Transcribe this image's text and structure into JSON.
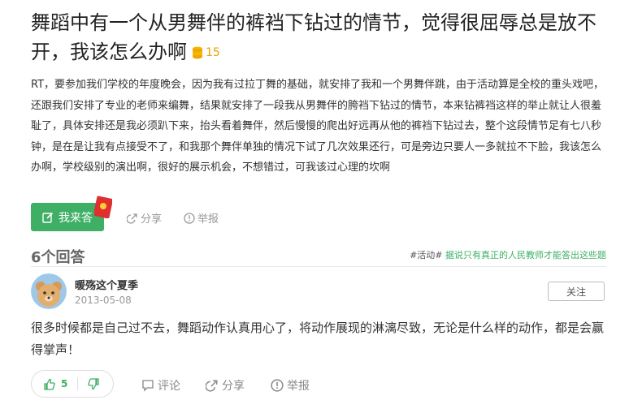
{
  "question": {
    "title": "舞蹈中有一个从男舞伴的裤裆下钻过的情节，觉得很屈辱总是放不开，我该怎么办啊",
    "coins": "15",
    "body": "RT，要参加我们学校的年度晚会，因为我有过拉丁舞的基础，就安排了我和一个男舞伴跳，由于活动算是全校的重头戏吧，还跟我们安排了专业的老师来编舞，结果就安排了一段我从男舞伴的胯裆下钻过的情节，本来钻裤裆这样的举止就让人很羞耻了，具体安排还是我必须趴下来，抬头看着舞伴，然后慢慢的爬出好远再从他的裤裆下钻过去，整个这段情节足有七八秒钟，是在是让我有点接受不了，和我那个舞伴单独的情况下试了几次效果还行，可是旁边只要人一多就拉不下脸，我该怎么办啊，学校级别的演出啊，很好的展示机会，不想错过，可我该过心理的坎啊"
  },
  "question_actions": {
    "answer_label": "我来答",
    "share_label": "分享",
    "report_label": "举报"
  },
  "answers_header": {
    "count_label": "6个回答",
    "activity_tag": "#活动#",
    "activity_link": "据说只有真正的人民教师才能答出这些题"
  },
  "answer": {
    "user_name": "暖殇这个夏季",
    "date": "2013-05-08",
    "follow_label": "关注",
    "text": "很多时候都是自己过不去，舞蹈动作认真用心了，将动作展现的淋漓尽致，无论是什么样的动作，都是会赢得掌声！",
    "upvotes": "5",
    "comment_label": "评论",
    "share_label": "分享",
    "report_label": "举报"
  },
  "colors": {
    "accent_green": "#3eaf64",
    "coin_gold": "#e8a300",
    "red_packet": "#e02f2f"
  }
}
